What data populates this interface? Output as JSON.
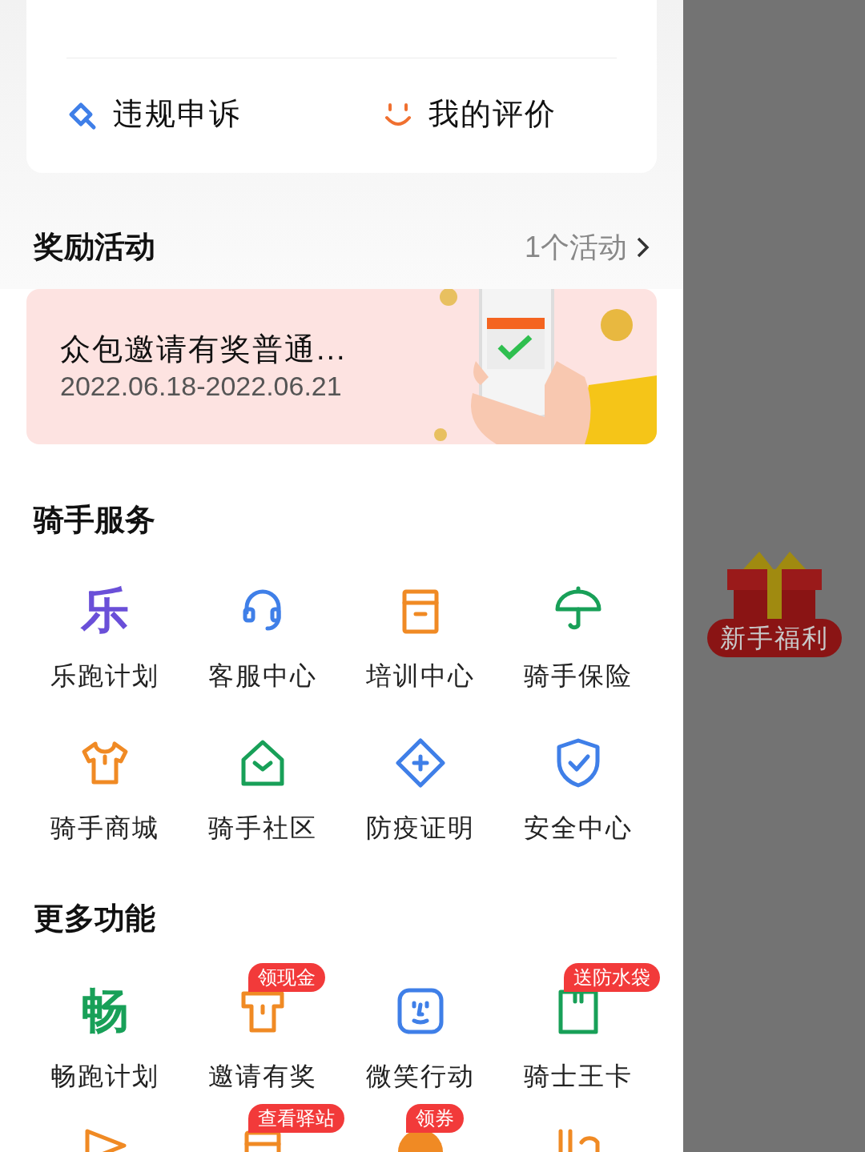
{
  "quick_links": [
    {
      "kind": "appeal",
      "label": "违规申诉"
    },
    {
      "kind": "smile",
      "label": "我的评价"
    }
  ],
  "rewards": {
    "title": "奖励活动",
    "count": "1个活动",
    "banner": {
      "title": "众包邀请有奖普通...",
      "dates": "2022.06.18-2022.06.21",
      "kind": "picture"
    }
  },
  "rider_services": {
    "title": "骑手服务",
    "items": [
      {
        "kind": "le",
        "glyph": "乐",
        "label": "乐跑计划",
        "color": "#6a4fd8"
      },
      {
        "kind": "headset",
        "label": "客服中心",
        "color": "#3f7fe8"
      },
      {
        "kind": "box",
        "label": "培训中心",
        "color": "#f08a24"
      },
      {
        "kind": "umbrella",
        "label": "骑手保险",
        "color": "#18a058"
      },
      {
        "kind": "shirt",
        "label": "骑手商城",
        "color": "#f08a24"
      },
      {
        "kind": "house",
        "label": "骑手社区",
        "color": "#18a058"
      },
      {
        "kind": "diamond",
        "label": "防疫证明",
        "color": "#3f7fe8"
      },
      {
        "kind": "shield",
        "label": "安全中心",
        "color": "#3f7fe8"
      }
    ]
  },
  "more_features": {
    "title": "更多功能",
    "items": [
      {
        "kind": "le",
        "glyph": "畅",
        "label": "畅跑计划",
        "color": "#18a058"
      },
      {
        "kind": "shirt-flat",
        "label": "邀请有奖",
        "color": "#f08a24",
        "badge": "领现金"
      },
      {
        "kind": "face",
        "label": "微笑行动",
        "color": "#3f7fe8"
      },
      {
        "kind": "card",
        "label": "骑士王卡",
        "color": "#18a058",
        "badge": "送防水袋"
      },
      {
        "kind": "flag",
        "color": "#f08a24"
      },
      {
        "kind": "box",
        "color": "#f08a24",
        "badge": "查看驿站"
      },
      {
        "kind": "ring",
        "color": "#f08a24",
        "badge": "领券"
      },
      {
        "kind": "dots",
        "color": "#f08a24"
      }
    ]
  },
  "floating_promo": {
    "label": "新手福利"
  }
}
